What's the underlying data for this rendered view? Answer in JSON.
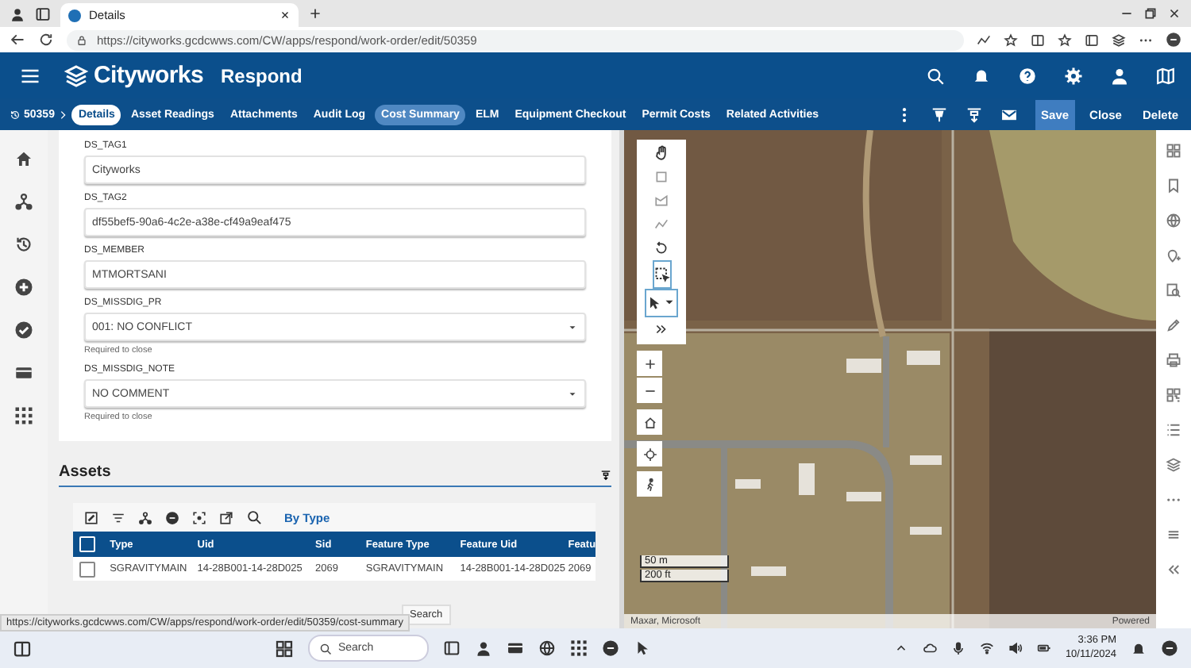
{
  "browser": {
    "tab_title": "Details",
    "url": "https://cityworks.gcdcwws.com/CW/apps/respond/work-order/edit/50359",
    "status_url": "https://cityworks.gcdcwws.com/CW/apps/respond/work-order/edit/50359/cost-summary"
  },
  "app": {
    "brand": "Cityworks",
    "product": "Respond"
  },
  "record": "50359",
  "tabs": [
    {
      "label": "Details",
      "selected": true,
      "hovered": false
    },
    {
      "label": "Asset Readings",
      "selected": false,
      "hovered": false
    },
    {
      "label": "Attachments",
      "selected": false,
      "hovered": false
    },
    {
      "label": "Audit Log",
      "selected": false,
      "hovered": false
    },
    {
      "label": "Cost Summary",
      "selected": false,
      "hovered": true
    },
    {
      "label": "ELM",
      "selected": false,
      "hovered": false
    },
    {
      "label": "Equipment Checkout",
      "selected": false,
      "hovered": false
    },
    {
      "label": "Permit Costs",
      "selected": false,
      "hovered": false
    },
    {
      "label": "Related Activities",
      "selected": false,
      "hovered": false
    }
  ],
  "actions": [
    {
      "label": "Save",
      "highlighted": true
    },
    {
      "label": "Close",
      "highlighted": false
    },
    {
      "label": "Delete",
      "highlighted": false
    }
  ],
  "fields": [
    {
      "label": "DS_TAG1",
      "kind": "text",
      "value": "Cityworks"
    },
    {
      "label": "DS_TAG2",
      "kind": "text",
      "value": "df55bef5-90a6-4c2e-a38e-cf49a9eaf475"
    },
    {
      "label": "DS_MEMBER",
      "kind": "text",
      "value": "MTMORTSANI"
    },
    {
      "label": "DS_MISSDIG_PR",
      "kind": "select",
      "value": "001: NO CONFLICT",
      "hint": "Required to close"
    },
    {
      "label": "DS_MISSDIG_NOTE",
      "kind": "select",
      "value": "NO COMMENT",
      "hint": "Required to close"
    }
  ],
  "assets": {
    "title": "Assets",
    "view_link": "By Type",
    "all_checked": false,
    "columns": [
      "Type",
      "Uid",
      "Sid",
      "Feature Type",
      "Feature Uid",
      "Featu"
    ],
    "rows": [
      {
        "checked": false,
        "cells": [
          "SGRAVITYMAIN",
          "14-28B001-14-28D025",
          "2069",
          "SGRAVITYMAIN",
          "14-28B001-14-28D025",
          "2069"
        ]
      }
    ]
  },
  "tooltip": "Search",
  "map": {
    "scale": [
      "50 m",
      "200 ft"
    ],
    "attribution": "Maxar, Microsoft",
    "powered": "Powered"
  },
  "taskbar": {
    "search_placeholder": "Search",
    "time": "3:36 PM",
    "date": "10/11/2024"
  }
}
